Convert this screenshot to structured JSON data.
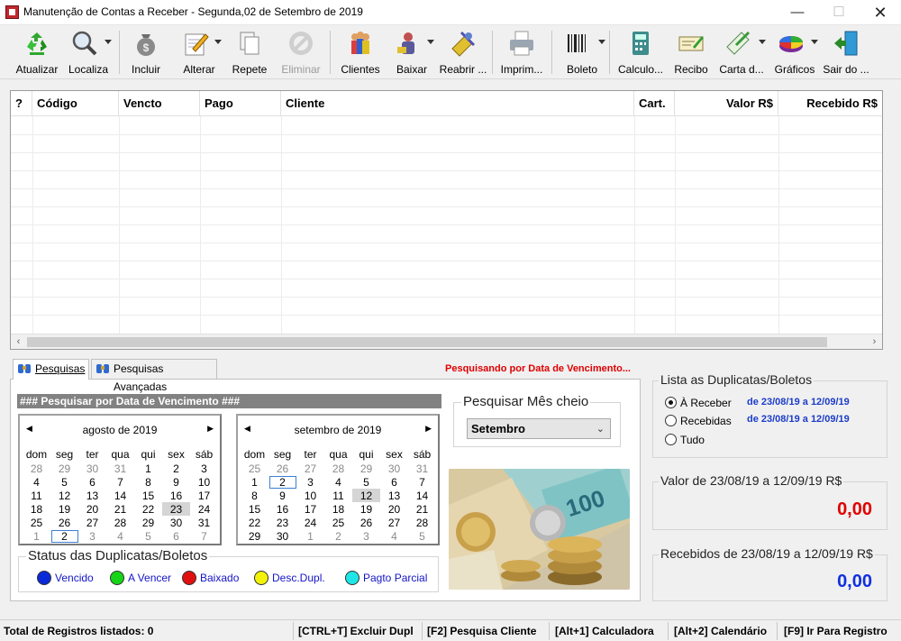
{
  "window": {
    "title": "Manutenção de Contas a Receber - Segunda,02 de Setembro de 2019",
    "min": "—",
    "max": "☐",
    "close": "✕"
  },
  "toolbar": {
    "atualizar": "Atualizar",
    "localiza": "Localiza",
    "incluir": "Incluir",
    "alterar": "Alterar",
    "repete": "Repete",
    "eliminar": "Eliminar",
    "clientes": "Clientes",
    "baixar": "Baixar",
    "reabrir": "Reabrir ...",
    "imprimir": "Imprim...",
    "boleto": "Boleto",
    "calculo": "Calculo...",
    "recibo": "Recibo",
    "carta": "Carta d...",
    "graficos": "Gráficos",
    "sair": "Sair do ..."
  },
  "grid": {
    "columns": [
      "?",
      "Código",
      "Vencto",
      "Pago",
      "Cliente",
      "Cart.",
      "Valor R$",
      "Recebido R$"
    ],
    "rows": [],
    "scroll_left": "‹",
    "scroll_right": "›"
  },
  "tabs": {
    "pesquisas": "Pesquisas",
    "avancadas": "Pesquisas Avançadas"
  },
  "search_status": "Pesquisando por Data de Vencimento...",
  "section_title": "### Pesquisar por Data de Vencimento ###",
  "calendars": [
    {
      "month": "agosto de 2019",
      "days": [
        [
          "28",
          "29",
          "30",
          "31",
          "1",
          "2",
          "3"
        ],
        [
          "4",
          "5",
          "6",
          "7",
          "8",
          "9",
          "10"
        ],
        [
          "11",
          "12",
          "13",
          "14",
          "15",
          "16",
          "17"
        ],
        [
          "18",
          "19",
          "20",
          "21",
          "22",
          "23",
          "24"
        ],
        [
          "25",
          "26",
          "27",
          "28",
          "29",
          "30",
          "31"
        ],
        [
          "1",
          "2",
          "3",
          "4",
          "5",
          "6",
          "7"
        ]
      ]
    },
    {
      "month": "setembro de 2019",
      "days": [
        [
          "25",
          "26",
          "27",
          "28",
          "29",
          "30",
          "31"
        ],
        [
          "1",
          "2",
          "3",
          "4",
          "5",
          "6",
          "7"
        ],
        [
          "8",
          "9",
          "10",
          "11",
          "12",
          "13",
          "14"
        ],
        [
          "15",
          "16",
          "17",
          "18",
          "19",
          "20",
          "21"
        ],
        [
          "22",
          "23",
          "24",
          "25",
          "26",
          "27",
          "28"
        ],
        [
          "29",
          "30",
          "1",
          "2",
          "3",
          "4",
          "5"
        ]
      ]
    }
  ],
  "weekdays": [
    "dom",
    "seg",
    "ter",
    "qua",
    "qui",
    "sex",
    "sáb"
  ],
  "cal_nav": {
    "prev": "◀",
    "next": "▶"
  },
  "mes_cheio": {
    "legend": "Pesquisar Mês cheio",
    "selected": "Setembro",
    "chevron": "⌄"
  },
  "status_legend": {
    "legend": "Status das Duplicatas/Boletos",
    "items": [
      {
        "label": "Vencido",
        "color": "#0a2ad8"
      },
      {
        "label": "A Vencer",
        "color": "#16d416"
      },
      {
        "label": "Baixado",
        "color": "#e01010"
      },
      {
        "label": "Desc.Dupl.",
        "color": "#f2f20a"
      },
      {
        "label": "Pagto Parcial",
        "color": "#1ee6e6"
      }
    ]
  },
  "lista": {
    "legend": "Lista as Duplicatas/Boletos",
    "a_receber": "À Receber",
    "recebidas": "Recebidas",
    "tudo": "Tudo",
    "range_receber": "de 23/08/19 a 12/09/19",
    "range_recebidas": "de 23/08/19 a 12/09/19"
  },
  "valor": {
    "legend": "Valor de 23/08/19 a 12/09/19 R$",
    "amount": "0,00",
    "color": "#e00000"
  },
  "recebidos": {
    "legend": "Recebidos de 23/08/19 a 12/09/19 R$",
    "amount": "0,00",
    "color": "#1030e0"
  },
  "statusbar": {
    "total": "Total de Registros listados: 0",
    "excluir": "[CTRL+T] Excluir Dupl",
    "pesquisa": "[F2] Pesquisa Cliente",
    "calc": "[Alt+1] Calculadora",
    "calendario": "[Alt+2] Calendário",
    "registro": "[F9] Ir Para Registro"
  }
}
